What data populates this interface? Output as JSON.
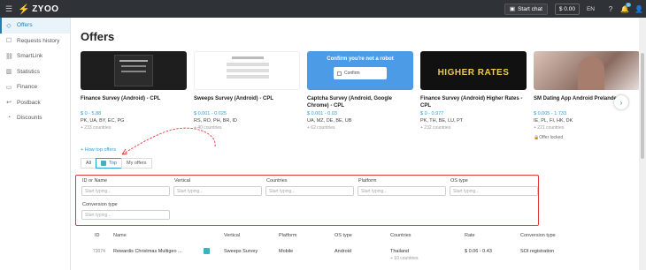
{
  "topbar": {
    "logo_text": "ZYOO",
    "start_chat_label": "Start chat",
    "balance": "$ 0.00",
    "language": "EN",
    "notifications_count": "0"
  },
  "sidebar": {
    "items": [
      {
        "label": "Offers",
        "icon": "tag-icon"
      },
      {
        "label": "Requests history",
        "icon": "history-icon"
      },
      {
        "label": "SmartLink",
        "icon": "link-icon"
      },
      {
        "label": "Statistics",
        "icon": "chart-icon"
      },
      {
        "label": "Finance",
        "icon": "wallet-icon"
      },
      {
        "label": "Postback",
        "icon": "postback-icon"
      },
      {
        "label": "Discounts",
        "icon": "discount-icon"
      }
    ]
  },
  "page": {
    "title": "Offers",
    "how_top_link": "+ How top offers"
  },
  "cards": [
    {
      "name": "Finance Survey (Android) - CPL",
      "rate": "$ 0 - 5.88",
      "geos": "PK, UA, BY, EC, PG",
      "more": "+ 233 countries",
      "locked": ""
    },
    {
      "name": "Sweeps Survey (Android) - CPL",
      "rate": "$ 0.001 - 0.025",
      "geos": "RS, RO, PH, BR, ID",
      "more": "+ 40 countries",
      "locked": ""
    },
    {
      "name": "Captcha Survey (Android, Google Chrome) - CPL",
      "rate": "$ 0.001 - 0.03",
      "geos": "UA, MZ, DE, BE, UB",
      "more": "+ 62 countries",
      "locked": "",
      "image_text": "Confirm you're not a robot",
      "image_checkbox_text": "Confirm"
    },
    {
      "name": "Finance Survey (Android) Higher Rates - CPL",
      "rate": "$ 0 - 0.977",
      "geos": "PK, TH, BE, LU, PT",
      "more": "+ 232 countries",
      "locked": "",
      "image_text": "HIGHER RATES"
    },
    {
      "name": "SM Dating App Android Prelander",
      "rate": "$ 0.005 - 1.733",
      "geos": "IE, PL, FI, HK, DK",
      "more": "+ 221 countries",
      "locked": "Offer locked"
    }
  ],
  "tabs": [
    {
      "label": "All",
      "active": false
    },
    {
      "label": "Top",
      "active": true
    },
    {
      "label": "My offers",
      "active": false
    }
  ],
  "filters": {
    "fields": [
      {
        "label": "ID or Name",
        "placeholder": "Start typing..."
      },
      {
        "label": "Vertical",
        "placeholder": "Start typing..."
      },
      {
        "label": "Countries",
        "placeholder": "Start typing..."
      },
      {
        "label": "Platform",
        "placeholder": "Start typing..."
      },
      {
        "label": "OS type",
        "placeholder": "Start typing..."
      },
      {
        "label": "Conversion type",
        "placeholder": "Start typing..."
      }
    ]
  },
  "table": {
    "headers": [
      "ID",
      "Name",
      "Vertical",
      "Platform",
      "OS type",
      "Countries",
      "Rate",
      "Conversion type"
    ],
    "rows": [
      {
        "id": "73074",
        "name": "Rewardis Christmas Multigeo ...",
        "vertical": "Sweeps Survey",
        "platform": "Mobile",
        "os": "Android",
        "country": "Thailand",
        "country_more": "+ 10 countries",
        "rate": "$ 0.06 - 0.43",
        "conversion": "SOI registration"
      }
    ]
  },
  "colors": {
    "accent": "#2a9fd6",
    "topbar": "#2f3236",
    "highlight_red": "#e23b3b"
  }
}
